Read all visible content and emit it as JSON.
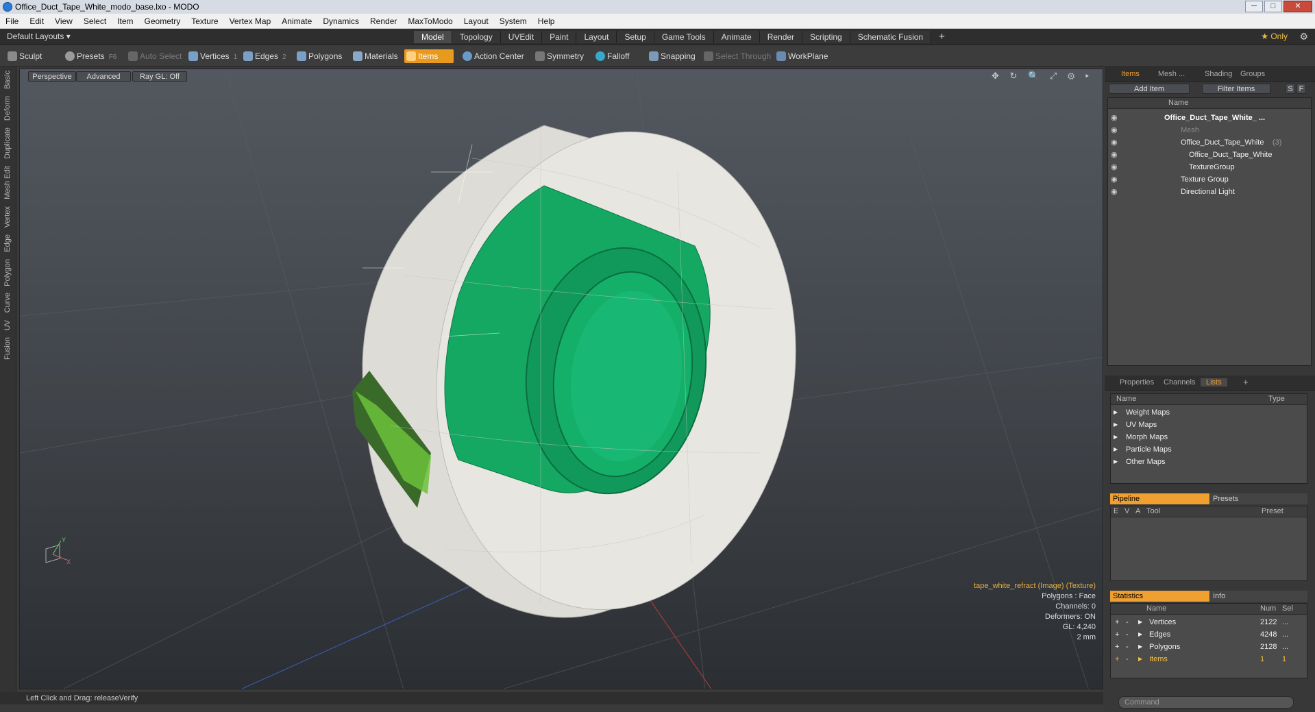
{
  "window": {
    "title": "Office_Duct_Tape_White_modo_base.lxo - MODO",
    "minimize": "─",
    "maximize": "□",
    "close": "✕"
  },
  "menubar": [
    "File",
    "Edit",
    "View",
    "Select",
    "Item",
    "Geometry",
    "Texture",
    "Vertex Map",
    "Animate",
    "Dynamics",
    "Render",
    "MaxToModo",
    "Layout",
    "System",
    "Help"
  ],
  "modebar": {
    "layouts": "Default Layouts ▾",
    "tabs": [
      "Model",
      "Topology",
      "UVEdit",
      "Paint",
      "Layout",
      "Setup",
      "Game Tools",
      "Animate",
      "Render",
      "Scripting",
      "Schematic Fusion"
    ],
    "active_tab": "Model",
    "plus": "+",
    "only": "★  Only",
    "gear": "⚙"
  },
  "toolbar": {
    "sculpt": "Sculpt",
    "presets": "Presets",
    "presets_key": "F6",
    "auto_select": "Auto Select",
    "vertices": "Vertices",
    "vertices_key": "1",
    "edges": "Edges",
    "edges_key": "2",
    "polygons": "Polygons",
    "materials": "Materials",
    "items": "Items",
    "action_center": "Action Center",
    "symmetry": "Symmetry",
    "falloff": "Falloff",
    "snapping": "Snapping",
    "select_through": "Select Through",
    "workplane": "WorkPlane"
  },
  "left_tabs": [
    "Basic",
    "Deform",
    "Duplicate",
    "Mesh Edit",
    "Vertex",
    "Edge",
    "Polygon",
    "Curve",
    "UV",
    "Fusion"
  ],
  "viewport": {
    "perspective": "Perspective",
    "advanced": "Advanced",
    "raygl": "Ray GL: Off",
    "icons": "✥ ↻ 🔍 ⤢ ⚙ ▸",
    "info": {
      "texture": "tape_white_refract (Image) (Texture)",
      "polygons": "Polygons : Face",
      "channels": "Channels: 0",
      "deformers": "Deformers: ON",
      "gl": "GL: 4,240",
      "units": "2 mm"
    },
    "axis_y": "Y",
    "axis_x": "X",
    "colors": {
      "tape_green": "#12a862",
      "body_white": "#e6e4de",
      "accent": "#e89a1e"
    }
  },
  "status": "Left Click and Drag:   releaseVerify",
  "items_panel": {
    "tabs": [
      "Items",
      "Mesh ...",
      "Shading",
      "Groups"
    ],
    "add_item": "Add Item",
    "filter_items": "Filter Items",
    "s": "S",
    "f": "F",
    "col_name": "Name",
    "tree": [
      {
        "label": "Office_Duct_Tape_White_  ...",
        "indent": 0,
        "bold": true
      },
      {
        "label": "Mesh",
        "indent": 1,
        "dim": true
      },
      {
        "label": "Office_Duct_Tape_White",
        "extra": "(3)",
        "indent": 1
      },
      {
        "label": "Office_Duct_Tape_White",
        "indent": 2
      },
      {
        "label": "TextureGroup",
        "indent": 2
      },
      {
        "label": "Texture Group",
        "indent": 1
      },
      {
        "label": "Directional Light",
        "indent": 1
      }
    ]
  },
  "props_panel": {
    "tabs": [
      "Properties",
      "Channels",
      "Lists"
    ],
    "plus": "+",
    "col_name": "Name",
    "col_type": "Type",
    "rows": [
      "Weight Maps",
      "UV Maps",
      "Morph Maps",
      "Particle Maps",
      "Other Maps"
    ]
  },
  "pipeline_panel": {
    "tab_pipeline": "Pipeline",
    "tab_presets": "Presets",
    "col_e": "E",
    "col_v": "V",
    "col_a": "A",
    "col_tool": "Tool",
    "col_preset": "Preset"
  },
  "stats_panel": {
    "tab_statistics": "Statistics",
    "tab_info": "Info",
    "col_name": "Name",
    "col_num": "Num",
    "col_sel": "Sel",
    "rows": [
      {
        "name": "Vertices",
        "num": "2122",
        "sel": "..."
      },
      {
        "name": "Edges",
        "num": "4248",
        "sel": "..."
      },
      {
        "name": "Polygons",
        "num": "2128",
        "sel": "..."
      },
      {
        "name": "Items",
        "num": "1",
        "sel": "1"
      }
    ]
  },
  "command": "Command"
}
